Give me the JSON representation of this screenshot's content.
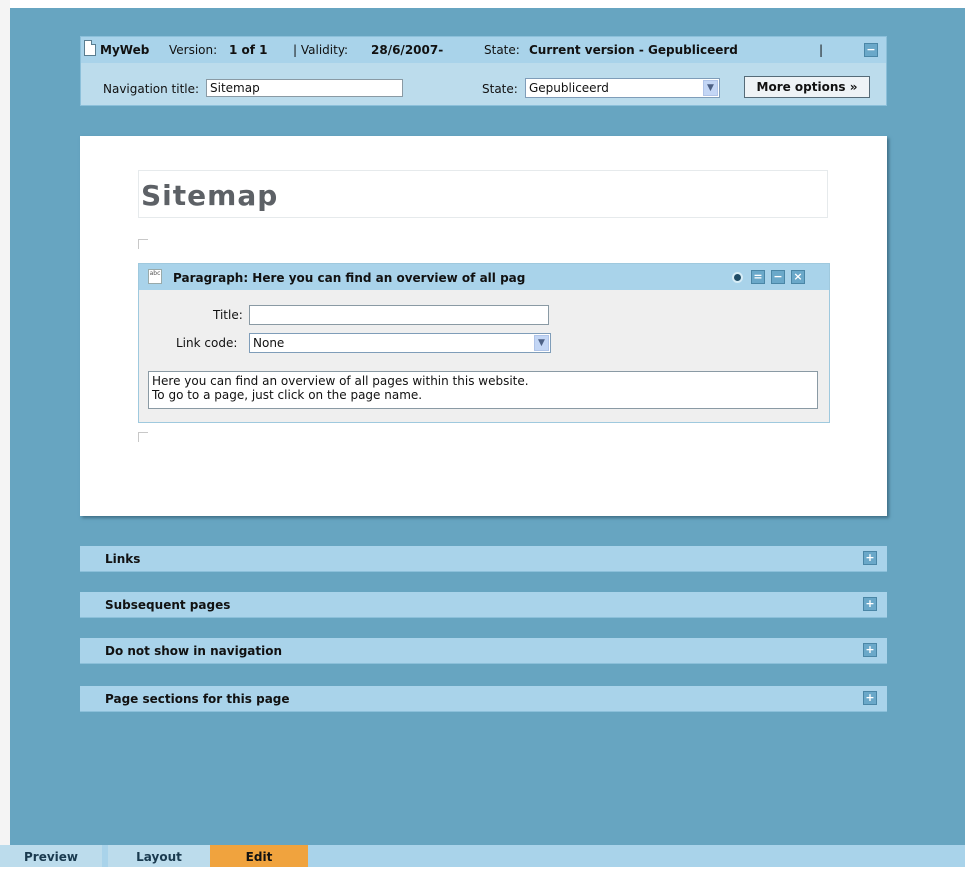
{
  "header": {
    "site_name": "MyWeb",
    "version_label": "Version:",
    "version_value": "1 of 1",
    "validity_label": "| Validity:",
    "validity_value": "28/6/2007-",
    "state_label": "State:",
    "state_value": "Current version - Gepubliceerd",
    "separator": "|",
    "collapse_symbol": "−",
    "nav_title_label": "Navigation title:",
    "nav_title_value": "Sitemap",
    "state_select_label": "State:",
    "state_select_value": "Gepubliceerd",
    "more_options_label": "More options »"
  },
  "content": {
    "page_title": "Sitemap",
    "paragraph": {
      "icon_text": "abc",
      "title": "Paragraph: Here you can find an overview of all pag",
      "title_field_label": "Title:",
      "title_field_value": "",
      "link_code_label": "Link code:",
      "link_code_value": "None",
      "body_text": "Here you can find an overview of all pages within this website.\nTo go to a page, just click on the page name."
    }
  },
  "sections": [
    {
      "label": "Links"
    },
    {
      "label": "Subsequent pages"
    },
    {
      "label": "Do not show in navigation"
    },
    {
      "label": "Page sections for this page"
    }
  ],
  "tabs": [
    {
      "label": "Preview",
      "active": false
    },
    {
      "label": "Layout",
      "active": false
    },
    {
      "label": "Edit",
      "active": true
    }
  ],
  "colors": {
    "background": "#67a5c1",
    "header_bar": "#a9d3ea",
    "active_tab": "#f0a33e",
    "inactive_tab": "#bcdcec"
  },
  "icons": {
    "plus": "+",
    "minus": "−",
    "close": "×",
    "arrow": "▼"
  }
}
